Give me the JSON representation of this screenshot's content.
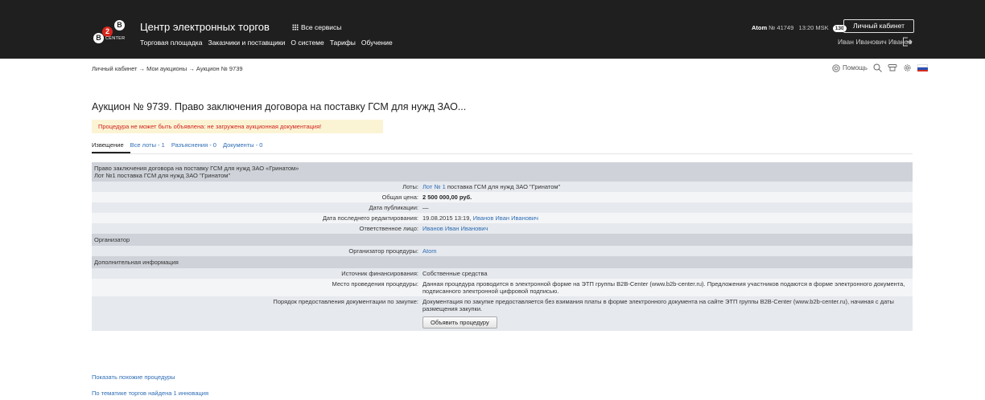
{
  "header": {
    "logo_letters": [
      "B",
      "2",
      "B"
    ],
    "logo_center": "CENTER",
    "site_title": "Центр электронных торгов",
    "all_services": "Все сервисы",
    "nav": [
      "Торговая площадка",
      "Заказчики и поставщики",
      "О системе",
      "Тарифы",
      "Обучение"
    ],
    "org_name": "Atom",
    "org_number": "№ 41749",
    "time": "13:20 MSK",
    "notifications": "130",
    "cabinet_button": "Личный кабинет",
    "user_name": "Иван Иванович Иванов"
  },
  "breadcrumb": {
    "items": [
      "Личный кабинет",
      "Мои аукционы",
      "Аукцион № 9739"
    ],
    "separator": "→"
  },
  "tools": {
    "help": "Помощь"
  },
  "page": {
    "title": "Аукцион № 9739. Право заключения договора на поставку ГСМ для нужд ЗАО...",
    "warning": "Процедура не может быть объявлена: не загружена аукционная документация!"
  },
  "tabs": [
    {
      "label": "Извещение",
      "active": true
    },
    {
      "label": "Все лоты - 1",
      "active": false
    },
    {
      "label": "Разъяснения - 0",
      "active": false
    },
    {
      "label": "Документы - 0",
      "active": false
    }
  ],
  "table": {
    "header_line1": "Право заключения договора на поставку ГСМ для нужд ЗАО «Гринатом»",
    "header_line2": "Лот №1 поставка ГСМ для нужд ЗАО \"Гринатом\"",
    "lots_label": "Лоты:",
    "lots_link": "Лот № 1",
    "lots_text": "поставка ГСМ для нужд ЗАО \"Гринатом\"",
    "price_label": "Общая цена:",
    "price_value": "2 500 000,00 руб.",
    "published_label": "Дата публикации:",
    "published_value": "—",
    "edited_label": "Дата последнего редактирования:",
    "edited_date": "19.08.2015 13:19,",
    "edited_by": "Иванов Иван Иванович",
    "responsible_label": "Ответственное лицо:",
    "responsible_value": "Иванов Иван Иванович",
    "organizer_section": "Организатор",
    "organizer_label": "Организатор процедуры:",
    "organizer_value": "Atom",
    "extra_section": "Дополнительная информация",
    "funding_label": "Источник финансирования:",
    "funding_value": "Собственные средства",
    "place_label": "Место проведения процедуры:",
    "place_value": "Данная процедура проводится в электронной форме на ЭТП группы B2B-Center (www.b2b-center.ru). Предложения участников подаются в форме электронного документа, подписанного электронной цифровой подписью.",
    "docs_label": "Порядок предоставления документации по закупке:",
    "docs_value": "Документация по закупке предоставляется без взимания платы в форме электронного документа на сайте ЭТП группы B2B-Center (www.b2b-center.ru), начиная с даты размещения закупки.",
    "announce_button": "Объявить процедуру"
  },
  "links": {
    "similar": "Показать похожие процедуры",
    "innovation": "По тематике торгов найдена 1 инновация"
  },
  "colors": {
    "header_bg": "#1f1f1f",
    "link": "#2e6db4",
    "warning_bg": "#fbf4d4",
    "warning_text": "#d2231f",
    "logo_red": "#d9261c"
  }
}
